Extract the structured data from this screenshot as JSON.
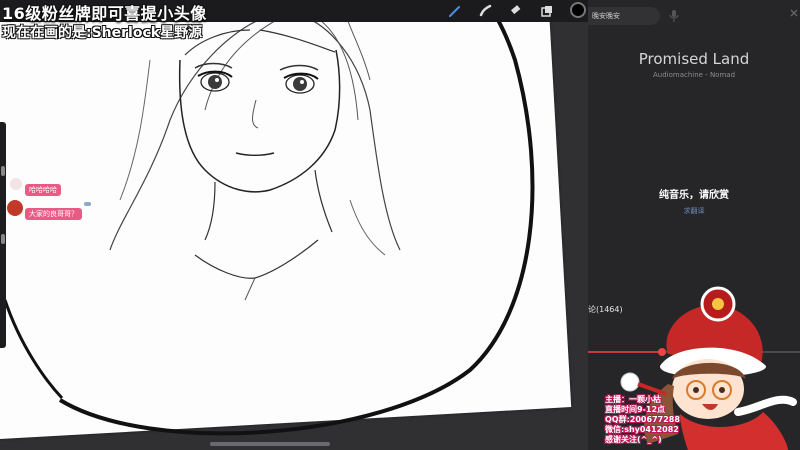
{
  "overlay": {
    "title": "16级粉丝牌即可喜提小头像",
    "subtitle": "现在在画的是:Sherlock星野源"
  },
  "chat": {
    "messages": [
      {
        "text": "哈哈哈哈"
      },
      {
        "text": "大家的良哥哥？"
      }
    ]
  },
  "toolbar": {
    "tools": [
      "brush-icon",
      "smudge-icon",
      "eraser-icon",
      "layers-icon"
    ],
    "current_color": "#000000"
  },
  "player": {
    "search_value": "晚安晚安",
    "song_title": "Promised Land",
    "song_artist": "Audiomachine - Nomad",
    "lyric": "纯音乐，请欣赏",
    "lyric_link": "求翻译",
    "comments_label": "论(1464)",
    "progress": 0.35,
    "accent_color": "#c43b3b"
  },
  "streamer_info": {
    "lines": [
      "主播：一颗小枯",
      "直播时间9-12点",
      "QQ群:200677288",
      "微信:shy0412082",
      "感谢关注(^_^)"
    ]
  }
}
